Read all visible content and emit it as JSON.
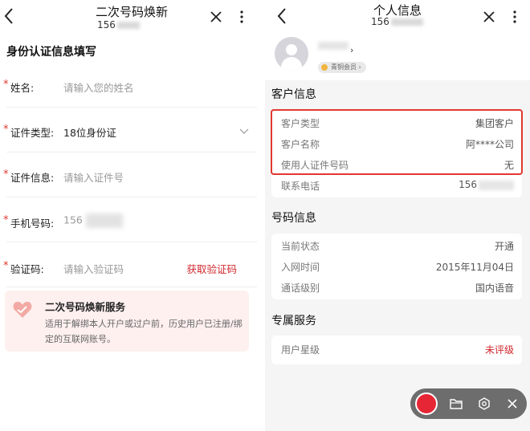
{
  "left": {
    "title": "二次号码焕新",
    "subtitle_prefix": "156",
    "section_heading": "身份认证信息填写",
    "fields": [
      {
        "label": "姓名:",
        "value": "请输入您的姓名",
        "required": true
      },
      {
        "label": "证件类型:",
        "value": "18位身份证",
        "required": true
      },
      {
        "label": "证件信息:",
        "value": "请输入证件号",
        "required": true
      },
      {
        "label": "手机号码:",
        "value": "156",
        "required": true
      },
      {
        "label": "验证码:",
        "value": "请输入验证码",
        "required": true,
        "action": "获取验证码"
      }
    ],
    "service": {
      "title": "二次号码焕新服务",
      "description": "适用于解绑本人开户或过户前，历史用户已注册/绑定的互联网账号。"
    }
  },
  "right": {
    "title": "个人信息",
    "subtitle_prefix": "156",
    "profile": {
      "chevron": "›",
      "badge": "青铜会员 ›"
    },
    "customer_section": "客户信息",
    "customer_rows": [
      {
        "key": "客户类型",
        "value": "集团客户"
      },
      {
        "key": "客户名称",
        "value": "阿****公司"
      },
      {
        "key": "使用人证件号码",
        "value": "无"
      },
      {
        "key": "联系电话",
        "value": "156"
      }
    ],
    "number_section": "号码信息",
    "number_rows": [
      {
        "key": "当前状态",
        "value": "开通"
      },
      {
        "key": "入网时间",
        "value": "2015年11月04日"
      },
      {
        "key": "通话级别",
        "value": "国内语音"
      }
    ],
    "exclusive_section": "专属服务",
    "exclusive_rows": [
      {
        "key": "用户星级",
        "value": "未评级"
      }
    ]
  },
  "colors": {
    "accent_red": "#d0282e",
    "highlight_border": "#e0392f",
    "record_red": "#e62634"
  },
  "icons": [
    "back-icon",
    "close-icon",
    "more-icon",
    "chevron-down-icon",
    "service-heart-icon",
    "avatar-icon",
    "record-icon",
    "folder-icon",
    "settings-icon"
  ]
}
